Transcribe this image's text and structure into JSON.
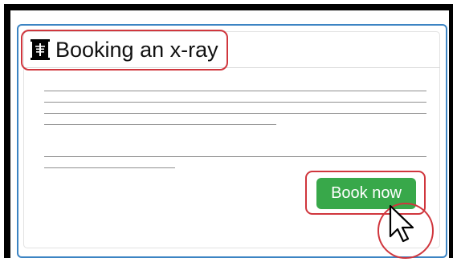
{
  "header": {
    "title": "Booking an x-ray",
    "icon": "x-ray-film-icon"
  },
  "content": {
    "placeholder_text_lines": 6
  },
  "actions": {
    "book_label": "Book now"
  },
  "cursor": {
    "icon": "mouse-pointer-icon"
  },
  "colors": {
    "frame": "#000000",
    "card_border": "#3c84c3",
    "highlight": "#d0363d",
    "button": "#38a84a",
    "button_text": "#ffffff"
  }
}
